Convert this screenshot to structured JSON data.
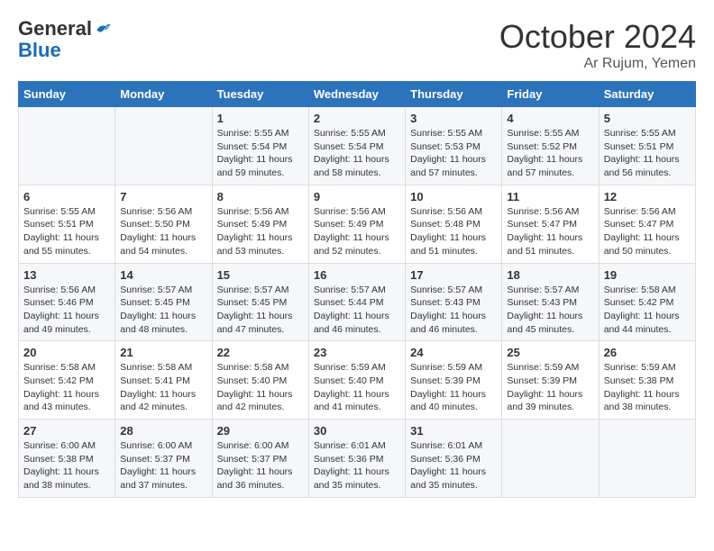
{
  "header": {
    "logo_general": "General",
    "logo_blue": "Blue",
    "month": "October 2024",
    "location": "Ar Rujum, Yemen"
  },
  "days_of_week": [
    "Sunday",
    "Monday",
    "Tuesday",
    "Wednesday",
    "Thursday",
    "Friday",
    "Saturday"
  ],
  "weeks": [
    [
      {
        "day": "",
        "sunrise": "",
        "sunset": "",
        "daylight": ""
      },
      {
        "day": "",
        "sunrise": "",
        "sunset": "",
        "daylight": ""
      },
      {
        "day": "1",
        "sunrise": "Sunrise: 5:55 AM",
        "sunset": "Sunset: 5:54 PM",
        "daylight": "Daylight: 11 hours and 59 minutes."
      },
      {
        "day": "2",
        "sunrise": "Sunrise: 5:55 AM",
        "sunset": "Sunset: 5:54 PM",
        "daylight": "Daylight: 11 hours and 58 minutes."
      },
      {
        "day": "3",
        "sunrise": "Sunrise: 5:55 AM",
        "sunset": "Sunset: 5:53 PM",
        "daylight": "Daylight: 11 hours and 57 minutes."
      },
      {
        "day": "4",
        "sunrise": "Sunrise: 5:55 AM",
        "sunset": "Sunset: 5:52 PM",
        "daylight": "Daylight: 11 hours and 57 minutes."
      },
      {
        "day": "5",
        "sunrise": "Sunrise: 5:55 AM",
        "sunset": "Sunset: 5:51 PM",
        "daylight": "Daylight: 11 hours and 56 minutes."
      }
    ],
    [
      {
        "day": "6",
        "sunrise": "Sunrise: 5:55 AM",
        "sunset": "Sunset: 5:51 PM",
        "daylight": "Daylight: 11 hours and 55 minutes."
      },
      {
        "day": "7",
        "sunrise": "Sunrise: 5:56 AM",
        "sunset": "Sunset: 5:50 PM",
        "daylight": "Daylight: 11 hours and 54 minutes."
      },
      {
        "day": "8",
        "sunrise": "Sunrise: 5:56 AM",
        "sunset": "Sunset: 5:49 PM",
        "daylight": "Daylight: 11 hours and 53 minutes."
      },
      {
        "day": "9",
        "sunrise": "Sunrise: 5:56 AM",
        "sunset": "Sunset: 5:49 PM",
        "daylight": "Daylight: 11 hours and 52 minutes."
      },
      {
        "day": "10",
        "sunrise": "Sunrise: 5:56 AM",
        "sunset": "Sunset: 5:48 PM",
        "daylight": "Daylight: 11 hours and 51 minutes."
      },
      {
        "day": "11",
        "sunrise": "Sunrise: 5:56 AM",
        "sunset": "Sunset: 5:47 PM",
        "daylight": "Daylight: 11 hours and 51 minutes."
      },
      {
        "day": "12",
        "sunrise": "Sunrise: 5:56 AM",
        "sunset": "Sunset: 5:47 PM",
        "daylight": "Daylight: 11 hours and 50 minutes."
      }
    ],
    [
      {
        "day": "13",
        "sunrise": "Sunrise: 5:56 AM",
        "sunset": "Sunset: 5:46 PM",
        "daylight": "Daylight: 11 hours and 49 minutes."
      },
      {
        "day": "14",
        "sunrise": "Sunrise: 5:57 AM",
        "sunset": "Sunset: 5:45 PM",
        "daylight": "Daylight: 11 hours and 48 minutes."
      },
      {
        "day": "15",
        "sunrise": "Sunrise: 5:57 AM",
        "sunset": "Sunset: 5:45 PM",
        "daylight": "Daylight: 11 hours and 47 minutes."
      },
      {
        "day": "16",
        "sunrise": "Sunrise: 5:57 AM",
        "sunset": "Sunset: 5:44 PM",
        "daylight": "Daylight: 11 hours and 46 minutes."
      },
      {
        "day": "17",
        "sunrise": "Sunrise: 5:57 AM",
        "sunset": "Sunset: 5:43 PM",
        "daylight": "Daylight: 11 hours and 46 minutes."
      },
      {
        "day": "18",
        "sunrise": "Sunrise: 5:57 AM",
        "sunset": "Sunset: 5:43 PM",
        "daylight": "Daylight: 11 hours and 45 minutes."
      },
      {
        "day": "19",
        "sunrise": "Sunrise: 5:58 AM",
        "sunset": "Sunset: 5:42 PM",
        "daylight": "Daylight: 11 hours and 44 minutes."
      }
    ],
    [
      {
        "day": "20",
        "sunrise": "Sunrise: 5:58 AM",
        "sunset": "Sunset: 5:42 PM",
        "daylight": "Daylight: 11 hours and 43 minutes."
      },
      {
        "day": "21",
        "sunrise": "Sunrise: 5:58 AM",
        "sunset": "Sunset: 5:41 PM",
        "daylight": "Daylight: 11 hours and 42 minutes."
      },
      {
        "day": "22",
        "sunrise": "Sunrise: 5:58 AM",
        "sunset": "Sunset: 5:40 PM",
        "daylight": "Daylight: 11 hours and 42 minutes."
      },
      {
        "day": "23",
        "sunrise": "Sunrise: 5:59 AM",
        "sunset": "Sunset: 5:40 PM",
        "daylight": "Daylight: 11 hours and 41 minutes."
      },
      {
        "day": "24",
        "sunrise": "Sunrise: 5:59 AM",
        "sunset": "Sunset: 5:39 PM",
        "daylight": "Daylight: 11 hours and 40 minutes."
      },
      {
        "day": "25",
        "sunrise": "Sunrise: 5:59 AM",
        "sunset": "Sunset: 5:39 PM",
        "daylight": "Daylight: 11 hours and 39 minutes."
      },
      {
        "day": "26",
        "sunrise": "Sunrise: 5:59 AM",
        "sunset": "Sunset: 5:38 PM",
        "daylight": "Daylight: 11 hours and 38 minutes."
      }
    ],
    [
      {
        "day": "27",
        "sunrise": "Sunrise: 6:00 AM",
        "sunset": "Sunset: 5:38 PM",
        "daylight": "Daylight: 11 hours and 38 minutes."
      },
      {
        "day": "28",
        "sunrise": "Sunrise: 6:00 AM",
        "sunset": "Sunset: 5:37 PM",
        "daylight": "Daylight: 11 hours and 37 minutes."
      },
      {
        "day": "29",
        "sunrise": "Sunrise: 6:00 AM",
        "sunset": "Sunset: 5:37 PM",
        "daylight": "Daylight: 11 hours and 36 minutes."
      },
      {
        "day": "30",
        "sunrise": "Sunrise: 6:01 AM",
        "sunset": "Sunset: 5:36 PM",
        "daylight": "Daylight: 11 hours and 35 minutes."
      },
      {
        "day": "31",
        "sunrise": "Sunrise: 6:01 AM",
        "sunset": "Sunset: 5:36 PM",
        "daylight": "Daylight: 11 hours and 35 minutes."
      },
      {
        "day": "",
        "sunrise": "",
        "sunset": "",
        "daylight": ""
      },
      {
        "day": "",
        "sunrise": "",
        "sunset": "",
        "daylight": ""
      }
    ]
  ]
}
